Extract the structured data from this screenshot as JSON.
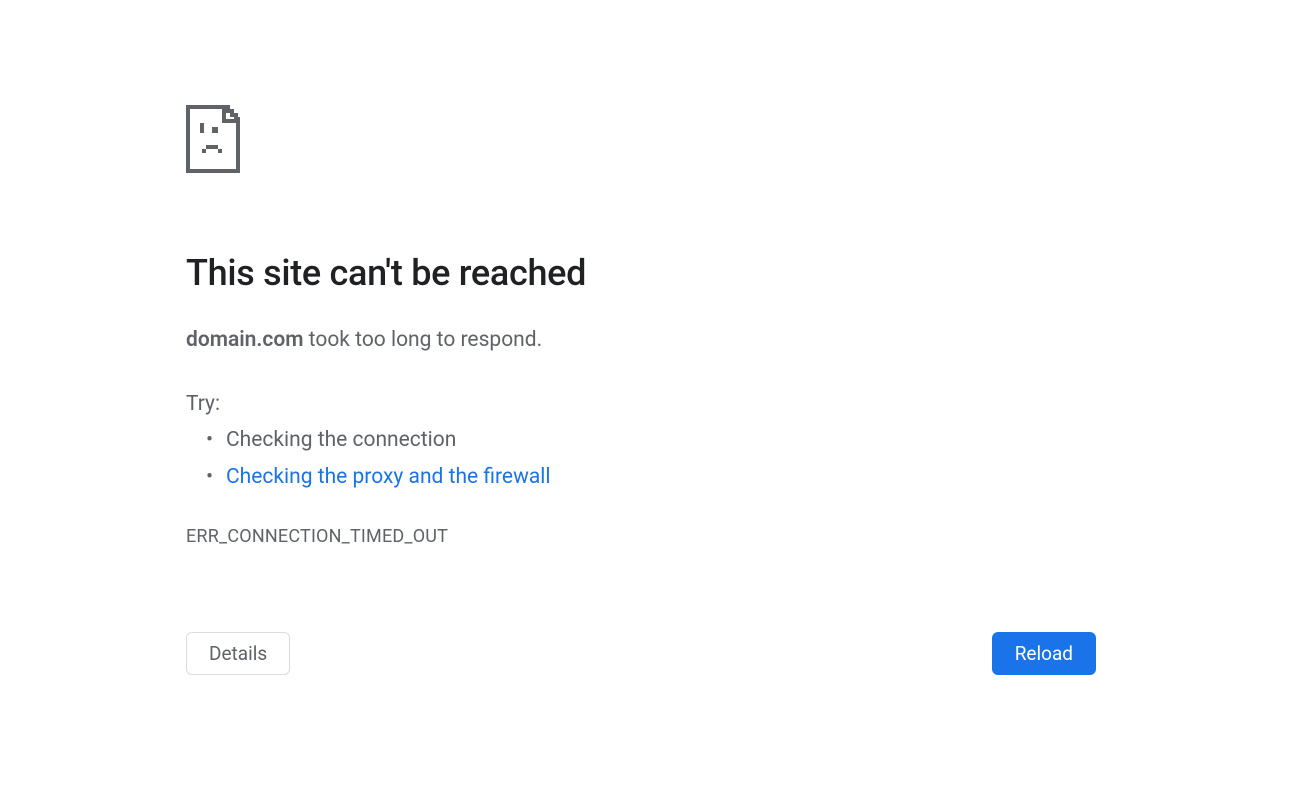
{
  "heading": "This site can't be reached",
  "message_bold": "domain.com",
  "message_rest": " took too long to respond.",
  "try_label": "Try:",
  "suggestions": {
    "plain": "Checking the connection",
    "link": "Checking the proxy and the firewall"
  },
  "error_code": "ERR_CONNECTION_TIMED_OUT",
  "buttons": {
    "details": "Details",
    "reload": "Reload"
  }
}
